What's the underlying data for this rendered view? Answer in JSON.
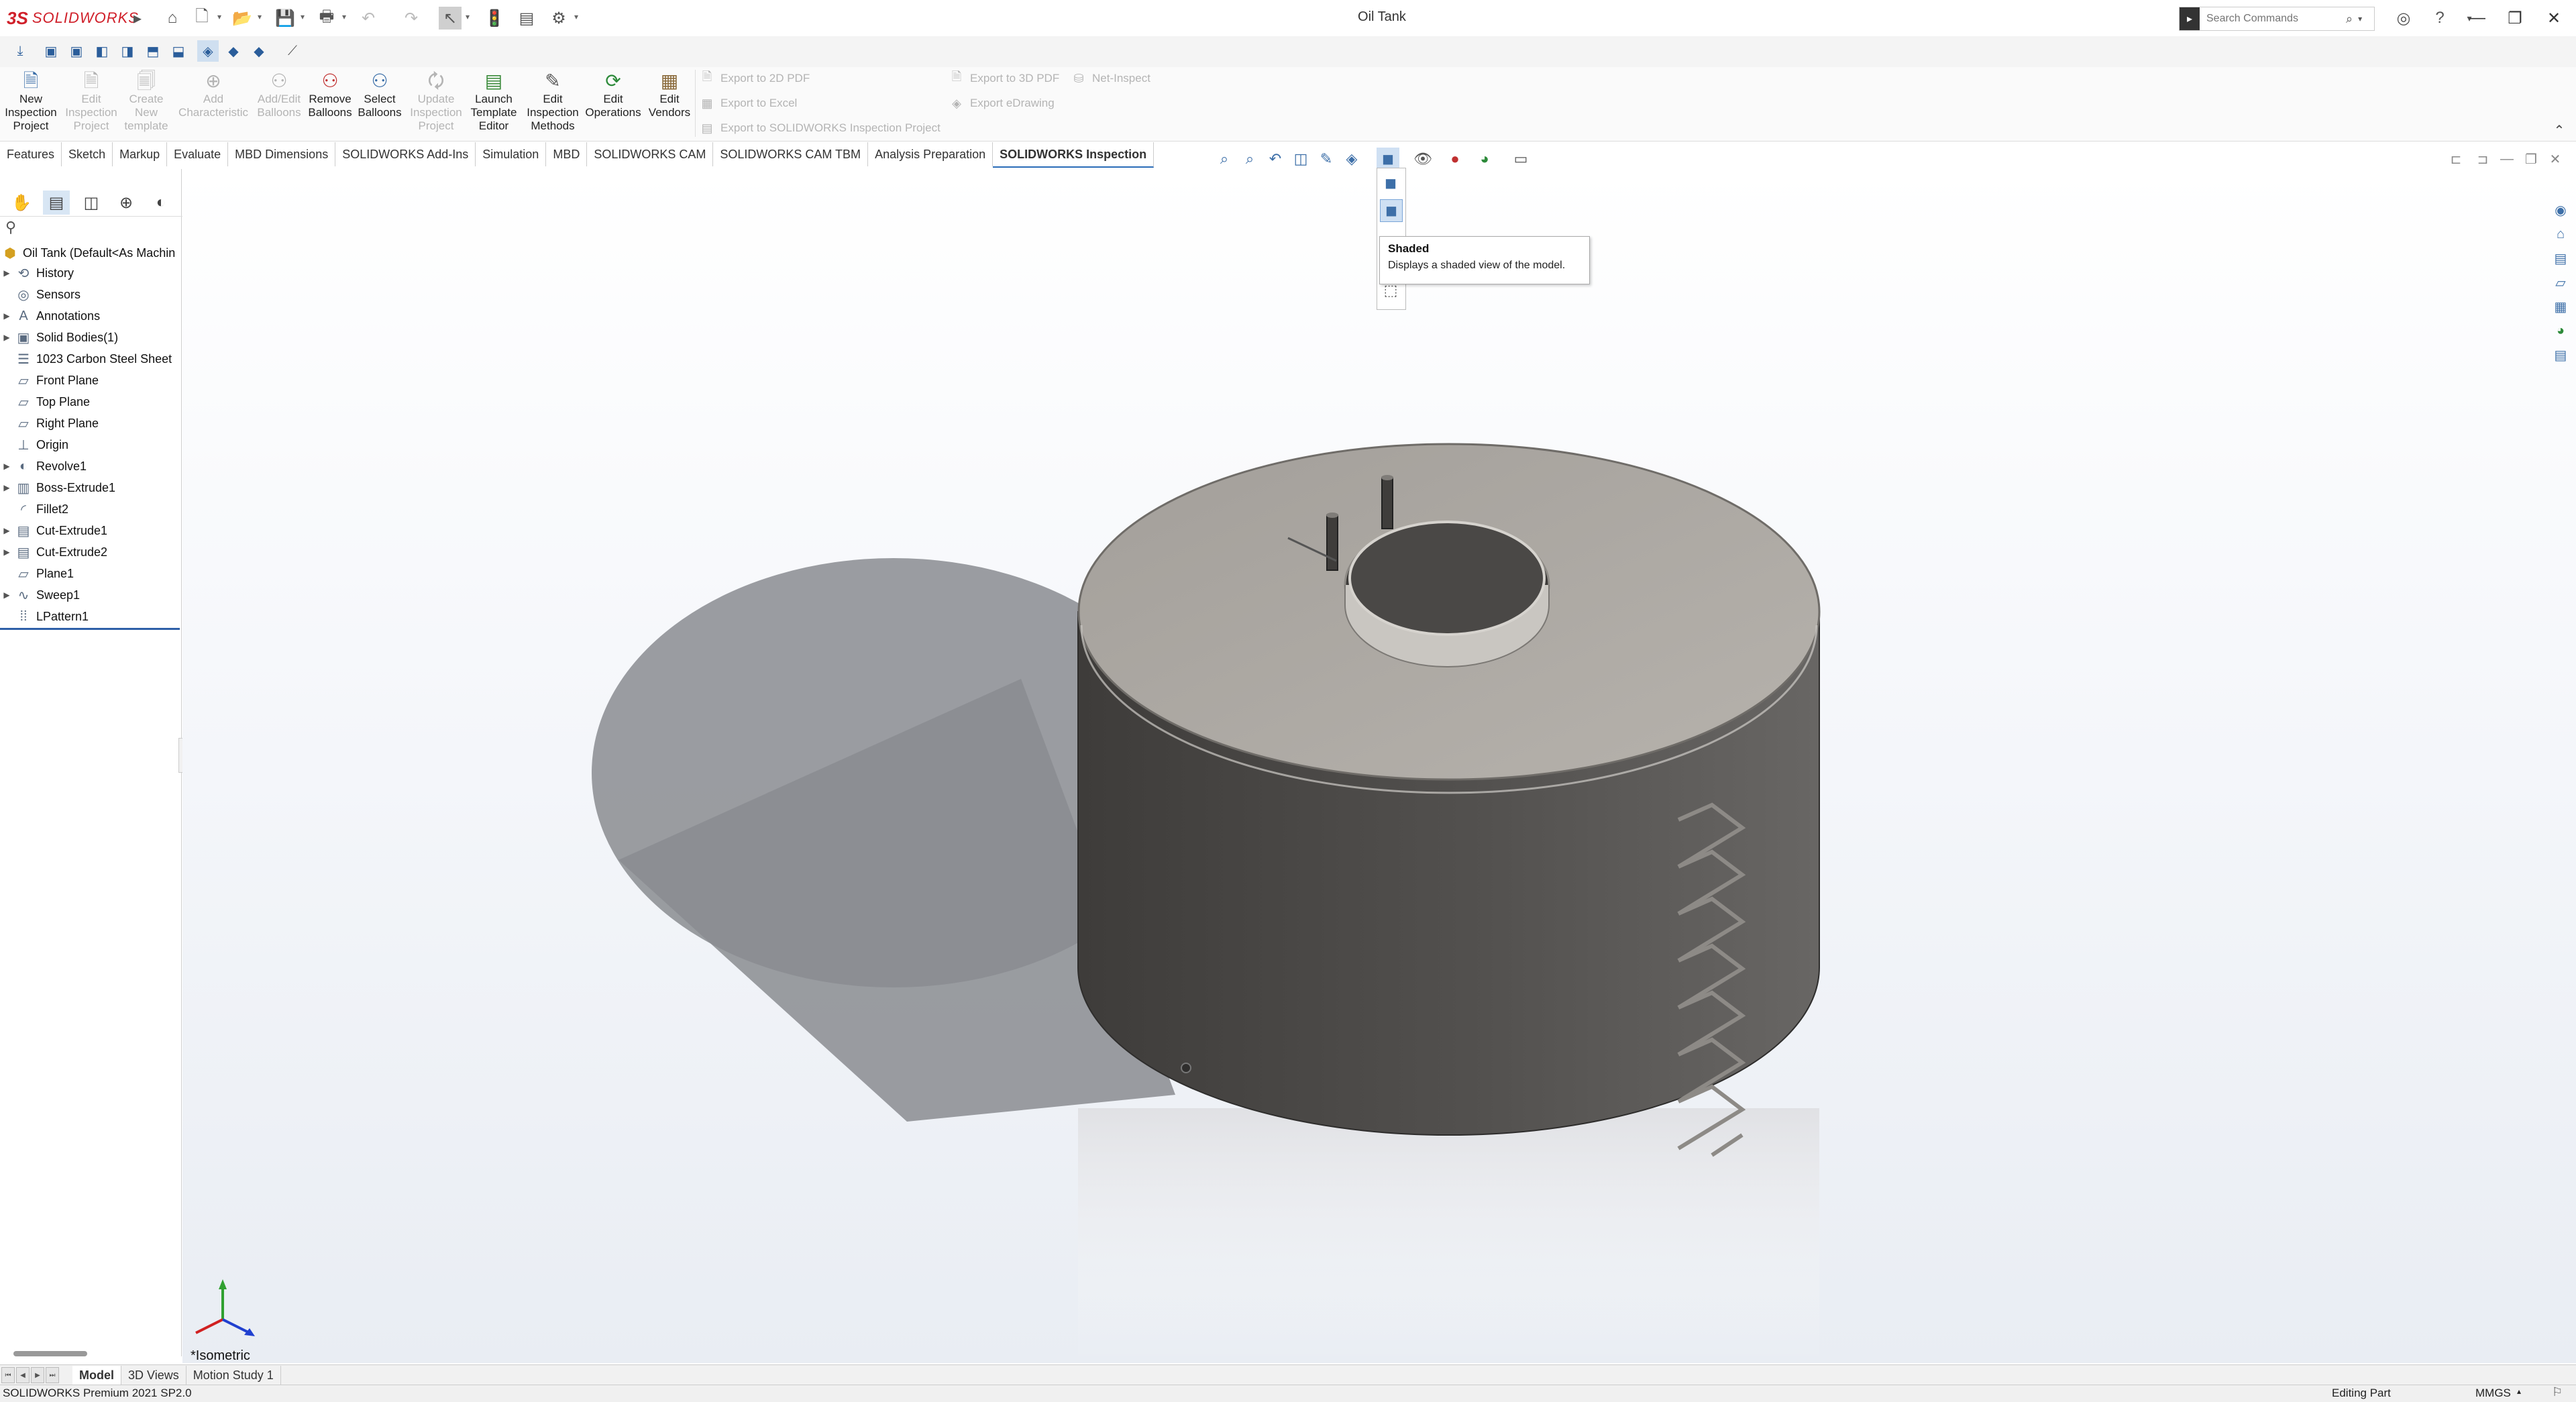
{
  "app": {
    "brand_ds": "3S",
    "brand_name": "SOLIDWORKS",
    "document_title": "Oil Tank",
    "accent_color": "#d0202a",
    "selection_color": "#2e5fa8"
  },
  "search": {
    "placeholder": "Search Commands"
  },
  "quick_access": [
    "home-icon",
    "new-document-icon",
    "open-icon",
    "save-icon",
    "print-icon",
    "undo-icon",
    "redo-icon",
    "select-pointer-icon",
    "rebuild-icon",
    "file-properties-icon",
    "options-icon"
  ],
  "command_manager": {
    "buttons": [
      {
        "label": "New\nInspection\nProject",
        "icon": "new-project-icon",
        "enabled": true
      },
      {
        "label": "Edit\nInspection\nProject",
        "icon": "edit-project-icon",
        "enabled": false
      },
      {
        "label": "Create\nNew\ntemplate",
        "icon": "template-icon",
        "enabled": false
      },
      {
        "label": "Add\nCharacteristic",
        "icon": "add-characteristic-icon",
        "enabled": false
      },
      {
        "label": "Add/Edit\nBalloons",
        "icon": "balloon-icon",
        "enabled": false
      },
      {
        "label": "Remove\nBalloons",
        "icon": "remove-balloon-icon",
        "enabled": true
      },
      {
        "label": "Select\nBalloons",
        "icon": "select-balloon-icon",
        "enabled": true
      },
      {
        "label": "Update\nInspection\nProject",
        "icon": "update-icon",
        "enabled": false
      },
      {
        "label": "Launch\nTemplate\nEditor",
        "icon": "template-editor-icon",
        "enabled": true
      },
      {
        "label": "Edit\nInspection\nMethods",
        "icon": "methods-icon",
        "enabled": true
      },
      {
        "label": "Edit\nOperations",
        "icon": "operations-icon",
        "enabled": true
      },
      {
        "label": "Edit\nVendors",
        "icon": "vendors-icon",
        "enabled": true
      }
    ],
    "export_col1": [
      "Export to 2D PDF",
      "Export to Excel",
      "Export to SOLIDWORKS Inspection Project"
    ],
    "export_col2": [
      "Export to 3D PDF",
      "Export eDrawing"
    ],
    "net_inspect": "Net-Inspect"
  },
  "tabs": [
    {
      "label": "Features"
    },
    {
      "label": "Sketch"
    },
    {
      "label": "Markup"
    },
    {
      "label": "Evaluate"
    },
    {
      "label": "MBD Dimensions"
    },
    {
      "label": "SOLIDWORKS Add-Ins"
    },
    {
      "label": "Simulation"
    },
    {
      "label": "MBD"
    },
    {
      "label": "SOLIDWORKS CAM"
    },
    {
      "label": "SOLIDWORKS CAM TBM"
    },
    {
      "label": "Analysis Preparation"
    },
    {
      "label": "SOLIDWORKS Inspection",
      "active": true
    }
  ],
  "feature_tree": {
    "root": "Oil Tank  (Default<As Machin",
    "items": [
      {
        "label": "History",
        "icon": "history-icon",
        "expandable": true
      },
      {
        "label": "Sensors",
        "icon": "sensor-icon",
        "expandable": false
      },
      {
        "label": "Annotations",
        "icon": "annotation-icon",
        "expandable": true
      },
      {
        "label": "Solid Bodies(1)",
        "icon": "solid-bodies-icon",
        "expandable": true
      },
      {
        "label": "1023 Carbon Steel Sheet",
        "icon": "material-icon",
        "expandable": false
      },
      {
        "label": "Front Plane",
        "icon": "plane-icon",
        "expandable": false
      },
      {
        "label": "Top Plane",
        "icon": "plane-icon",
        "expandable": false
      },
      {
        "label": "Right Plane",
        "icon": "plane-icon",
        "expandable": false
      },
      {
        "label": "Origin",
        "icon": "origin-icon",
        "expandable": false
      },
      {
        "label": "Revolve1",
        "icon": "revolve-icon",
        "expandable": true
      },
      {
        "label": "Boss-Extrude1",
        "icon": "extrude-icon",
        "expandable": true
      },
      {
        "label": "Fillet2",
        "icon": "fillet-icon",
        "expandable": false
      },
      {
        "label": "Cut-Extrude1",
        "icon": "cut-extrude-icon",
        "expandable": true
      },
      {
        "label": "Cut-Extrude2",
        "icon": "cut-extrude-icon",
        "expandable": true
      },
      {
        "label": "Plane1",
        "icon": "plane-icon",
        "expandable": false
      },
      {
        "label": "Sweep1",
        "icon": "sweep-icon",
        "expandable": true
      },
      {
        "label": "LPattern1",
        "icon": "linear-pattern-icon",
        "expandable": false
      }
    ]
  },
  "tooltip": {
    "title": "Shaded",
    "description": "Displays a shaded view of the model."
  },
  "viewport": {
    "view_name": "*Isometric",
    "background_top": "#ffffff",
    "background_bottom": "#e9edf3",
    "model_color": "#4f4d4b"
  },
  "bottom_tabs": [
    {
      "label": "Model",
      "active": true
    },
    {
      "label": "3D Views"
    },
    {
      "label": "Motion Study 1"
    }
  ],
  "status": {
    "version": "SOLIDWORKS Premium 2021 SP2.0",
    "mode": "Editing Part",
    "units": "MMGS"
  }
}
